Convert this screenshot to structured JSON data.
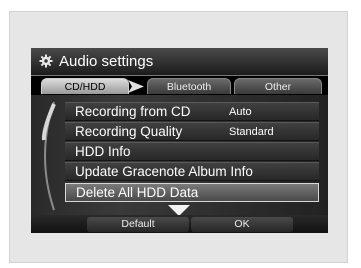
{
  "window": {
    "title": "Audio settings"
  },
  "tabs": [
    {
      "label": "CD/HDD"
    },
    {
      "label": "Bluetooth"
    },
    {
      "label": "Other"
    }
  ],
  "menu": {
    "items": [
      {
        "label": "Recording from CD",
        "value": "Auto"
      },
      {
        "label": "Recording Quality",
        "value": "Standard"
      },
      {
        "label": "HDD Info",
        "value": ""
      },
      {
        "label": "Update Gracenote Album Info",
        "value": ""
      },
      {
        "label": "Delete All HDD Data",
        "value": ""
      }
    ]
  },
  "footer": {
    "default_label": "Default",
    "ok_label": "OK"
  }
}
